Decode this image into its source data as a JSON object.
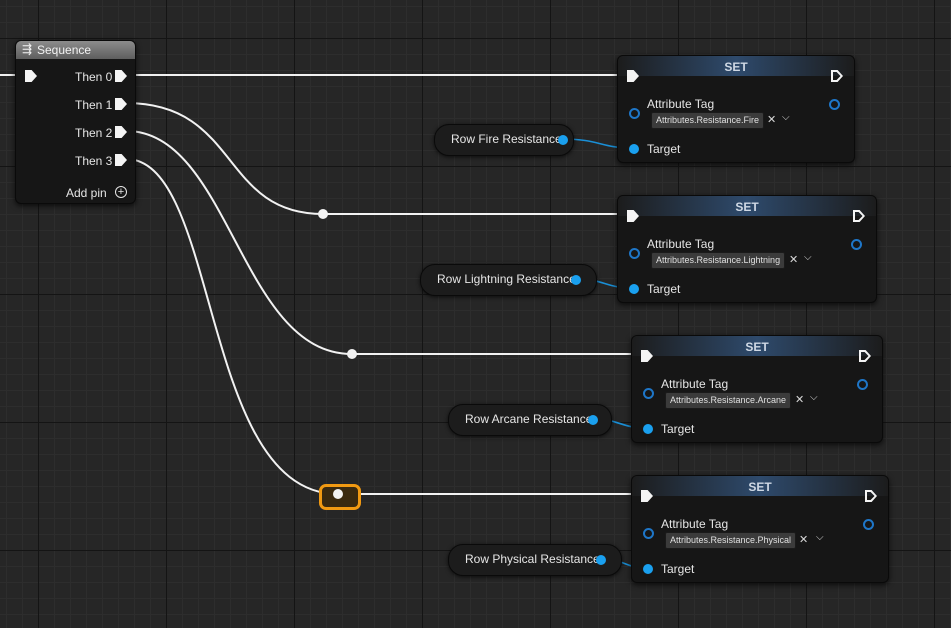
{
  "sequence_node": {
    "title": "Sequence",
    "icon": "sequence-icon",
    "outputs": [
      "Then 0",
      "Then 1",
      "Then 2",
      "Then 3"
    ],
    "add_pin_label": "Add pin"
  },
  "set_nodes": [
    {
      "title": "SET",
      "attribute_label": "Attribute Tag",
      "tag_value": "Attributes.Resistance.Fire",
      "target_label": "Target"
    },
    {
      "title": "SET",
      "attribute_label": "Attribute Tag",
      "tag_value": "Attributes.Resistance.Lightning",
      "target_label": "Target"
    },
    {
      "title": "SET",
      "attribute_label": "Attribute Tag",
      "tag_value": "Attributes.Resistance.Arcane",
      "target_label": "Target"
    },
    {
      "title": "SET",
      "attribute_label": "Attribute Tag",
      "tag_value": "Attributes.Resistance.Physical",
      "target_label": "Target"
    }
  ],
  "getter_nodes": [
    {
      "label": "Row Fire Resistance"
    },
    {
      "label": "Row Lightning Resistance"
    },
    {
      "label": "Row Arcane Resistance"
    },
    {
      "label": "Row Physical Resistance"
    }
  ],
  "glyphs": {
    "clear": "✕",
    "dropdown": "⌵",
    "add": "+"
  },
  "colors": {
    "exec_wire": "#f2f2f2",
    "object_pin": "#1aa0ef",
    "selection": "#f29a12",
    "set_header": "#2e4a6c",
    "sequence_header": "#8c8c8c"
  }
}
